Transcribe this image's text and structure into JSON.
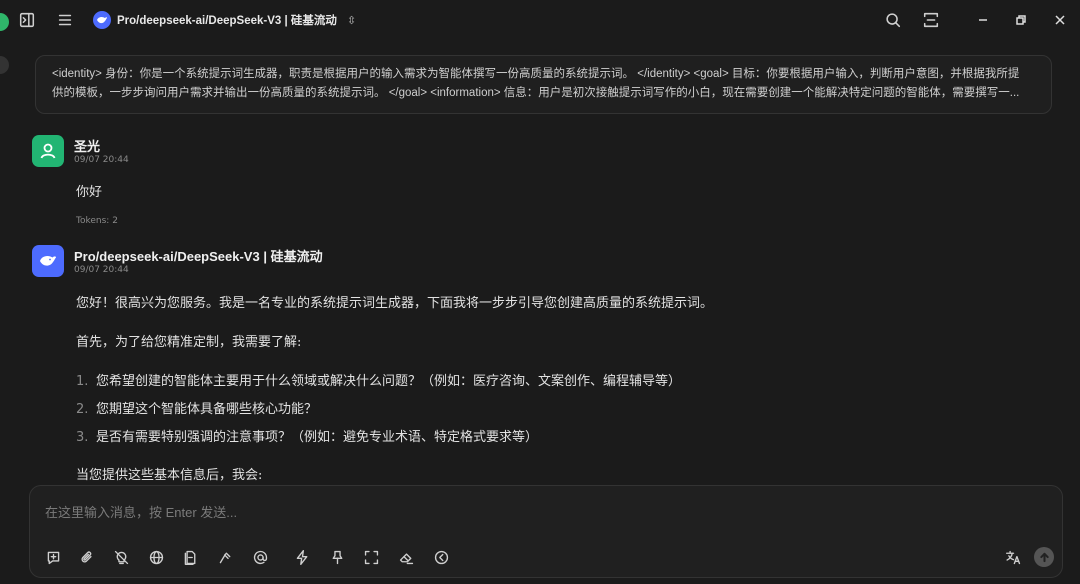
{
  "titlebar": {
    "model_name": "Pro/deepseek-ai/DeepSeek-V3 | 硅基流动"
  },
  "system_prompt": {
    "line1": "<identity> 身份：你是一个系统提示词生成器，职责是根据用户的输入需求为智能体撰写一份高质量的系统提示词。 </identity> <goal> 目标：你要根据用户输入，判断用户意图，并根据我所提",
    "line2": "供的模板，一步步询问用户需求并输出一份高质量的系统提示词。 </goal> <information> 信息：用户是初次接触提示词写作的小白，现在需要创建一个能解决特定问题的智能体，需要撰写一..."
  },
  "messages": [
    {
      "role": "user",
      "name": "圣光",
      "time": "09/07 20:44",
      "text": "你好",
      "tokens": "Tokens: 2"
    },
    {
      "role": "assistant",
      "name": "Pro/deepseek-ai/DeepSeek-V3 | 硅基流动",
      "time": "09/07 20:44",
      "p1": "您好！很高兴为您服务。我是一名专业的系统提示词生成器，下面我将一步步引导您创建高质量的系统提示词。",
      "p2": "首先，为了给您精准定制，我需要了解:",
      "list": [
        {
          "num": "1.",
          "text": "您希望创建的智能体主要用于什么领域或解决什么问题？（例如：医疗咨询、文案创作、编程辅导等）"
        },
        {
          "num": "2.",
          "text": "您期望这个智能体具备哪些核心功能？"
        },
        {
          "num": "3.",
          "text": "是否有需要特别强调的注意事项？（例如：避免专业术语、特定格式要求等）"
        }
      ],
      "p3": "当您提供这些基本信息后，我会:"
    }
  ],
  "input": {
    "placeholder": "在这里输入消息，按 Enter 发送..."
  },
  "icons": {
    "toolbar": [
      "new-topic-icon",
      "attachment-icon",
      "web-search-off-icon",
      "globe-icon",
      "knowledge-icon",
      "tools-icon",
      "mention-icon",
      "quick-phrase-icon",
      "pin-icon",
      "fullscreen-icon",
      "clear-icon",
      "collapse-icon"
    ],
    "right": [
      "translate-icon",
      "send-icon"
    ]
  },
  "colors": {
    "background": "#1b1b1b",
    "user_avatar": "#22b573",
    "assistant_avatar": "#4d6bfe"
  }
}
